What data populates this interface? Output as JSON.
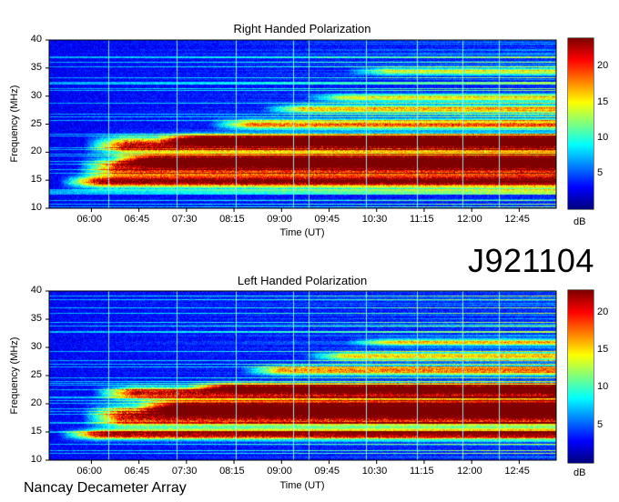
{
  "figure": {
    "code_label": "J921104",
    "footer_label": "Nancay Decameter Array",
    "x_axis_label": "Time (UT)",
    "y_axis_label": "Frequency (MHz)",
    "colorbar_unit": "dB"
  },
  "colorscale": {
    "stops": [
      "#00007f",
      "#0000ff",
      "#007fff",
      "#00ffff",
      "#7fff7f",
      "#ffff00",
      "#ff7f00",
      "#ff0000",
      "#7f0000"
    ]
  },
  "chart_data": [
    {
      "type": "heatmap",
      "title": "Right Handed Polarization",
      "xlabel": "Time (UT)",
      "ylabel": "Frequency (MHz)",
      "x_ticks": [
        "06:00",
        "06:45",
        "07:30",
        "08:15",
        "09:00",
        "09:45",
        "10:30",
        "11:15",
        "12:00",
        "12:45"
      ],
      "x_tick_minutes": [
        360,
        405,
        450,
        495,
        540,
        585,
        630,
        675,
        720,
        765
      ],
      "xlim_minutes": [
        320,
        800
      ],
      "ylim": [
        10,
        40
      ],
      "y_ticks": [
        10,
        15,
        20,
        25,
        30,
        35,
        40
      ],
      "colorbar": {
        "label": "dB",
        "range": [
          0,
          24
        ],
        "ticks": [
          5,
          10,
          15,
          20
        ]
      },
      "vertical_marker_minutes": [
        376,
        441,
        497,
        551,
        566,
        620,
        668,
        711,
        746
      ],
      "emission_bands_mhz": [
        {
          "center": 14.8,
          "width": 1.0,
          "start_minutes": 328,
          "level": 22
        },
        {
          "center": 17.3,
          "width": 1.6,
          "start_minutes": 345,
          "level": 20
        },
        {
          "center": 18.6,
          "width": 0.9,
          "start_minutes": 380,
          "level": 22
        },
        {
          "center": 21.3,
          "width": 1.4,
          "start_minutes": 352,
          "level": 21
        },
        {
          "center": 22.4,
          "width": 0.8,
          "start_minutes": 420,
          "level": 19
        },
        {
          "center": 25.0,
          "width": 0.8,
          "start_minutes": 470,
          "level": 16
        },
        {
          "center": 27.8,
          "width": 0.7,
          "start_minutes": 520,
          "level": 14
        },
        {
          "center": 29.8,
          "width": 0.6,
          "start_minutes": 560,
          "level": 12
        },
        {
          "center": 34.5,
          "width": 0.6,
          "start_minutes": 600,
          "level": 11
        }
      ]
    },
    {
      "type": "heatmap",
      "title": "Left Handed Polarization",
      "xlabel": "Time (UT)",
      "ylabel": "Frequency (MHz)",
      "x_ticks": [
        "06:00",
        "06:45",
        "07:30",
        "08:15",
        "09:00",
        "09:45",
        "10:30",
        "11:15",
        "12:00",
        "12:45"
      ],
      "x_tick_minutes": [
        360,
        405,
        450,
        495,
        540,
        585,
        630,
        675,
        720,
        765
      ],
      "xlim_minutes": [
        320,
        800
      ],
      "ylim": [
        10,
        40
      ],
      "y_ticks": [
        10,
        15,
        20,
        25,
        30,
        35,
        40
      ],
      "colorbar": {
        "label": "dB",
        "range": [
          0,
          23
        ],
        "ticks": [
          5,
          10,
          15,
          20
        ]
      },
      "vertical_marker_minutes": [
        376,
        441,
        497,
        551,
        566,
        620,
        668,
        711,
        746
      ],
      "emission_bands_mhz": [
        {
          "center": 14.6,
          "width": 0.8,
          "start_minutes": 328,
          "level": 21
        },
        {
          "center": 17.8,
          "width": 1.8,
          "start_minutes": 350,
          "level": 20
        },
        {
          "center": 19.5,
          "width": 1.2,
          "start_minutes": 400,
          "level": 19
        },
        {
          "center": 22.0,
          "width": 1.0,
          "start_minutes": 360,
          "level": 20
        },
        {
          "center": 23.0,
          "width": 0.7,
          "start_minutes": 450,
          "level": 17
        },
        {
          "center": 26.0,
          "width": 0.8,
          "start_minutes": 500,
          "level": 15
        },
        {
          "center": 28.5,
          "width": 0.7,
          "start_minutes": 560,
          "level": 13
        },
        {
          "center": 31.0,
          "width": 0.6,
          "start_minutes": 600,
          "level": 11
        }
      ]
    }
  ]
}
